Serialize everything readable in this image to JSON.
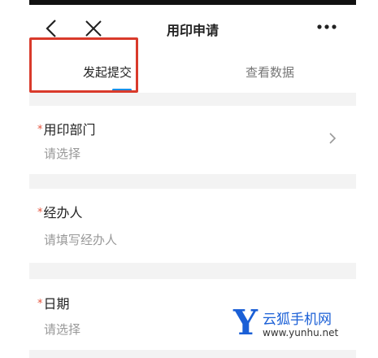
{
  "nav": {
    "title": "用印申请",
    "back_icon": "chevron-left-icon",
    "close_icon": "close-icon",
    "more_icon": "more-horizontal-icon"
  },
  "tabs": [
    {
      "label": "发起提交",
      "active": true
    },
    {
      "label": "查看数据",
      "active": false
    }
  ],
  "form": {
    "fields": [
      {
        "required_mark": "*",
        "label": "用印部门",
        "placeholder": "请选择",
        "has_chevron": true
      },
      {
        "required_mark": "*",
        "label": "经办人",
        "placeholder": "请填写经办人",
        "has_chevron": false
      },
      {
        "required_mark": "*",
        "label": "日期",
        "placeholder": "请选择",
        "has_chevron": false
      }
    ]
  },
  "watermark": {
    "brand": "云狐手机网",
    "url": "www.yunhu.net",
    "logo_letter": "Y"
  },
  "colors": {
    "accent": "#1a8fe6",
    "required": "#e5533c",
    "highlight": "#d93a2b",
    "watermark": "#1a5fd6"
  }
}
